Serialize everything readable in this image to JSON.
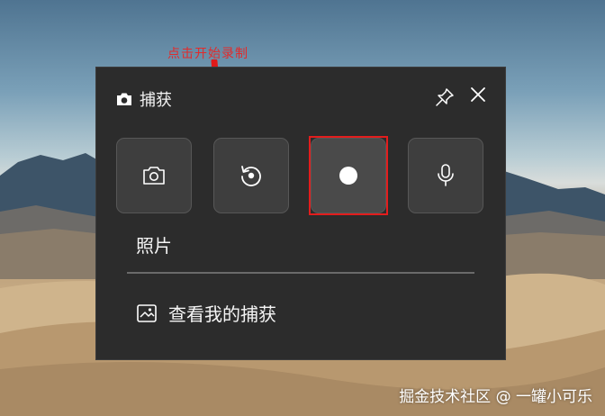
{
  "annotation": {
    "text": "点击开始录制"
  },
  "panel": {
    "title": "捕获",
    "buttons": [
      {
        "icon": "camera-icon"
      },
      {
        "icon": "replay-icon"
      },
      {
        "icon": "record-icon"
      },
      {
        "icon": "microphone-icon"
      }
    ],
    "mode_label": "照片",
    "gallery_label": "查看我的捕获"
  },
  "watermark": {
    "text": "掘金技术社区 @ 一罐小可乐"
  },
  "colors": {
    "highlight": "#e21d1d",
    "annotation": "#e22b2b",
    "panel_bg": "#2c2c2c"
  }
}
